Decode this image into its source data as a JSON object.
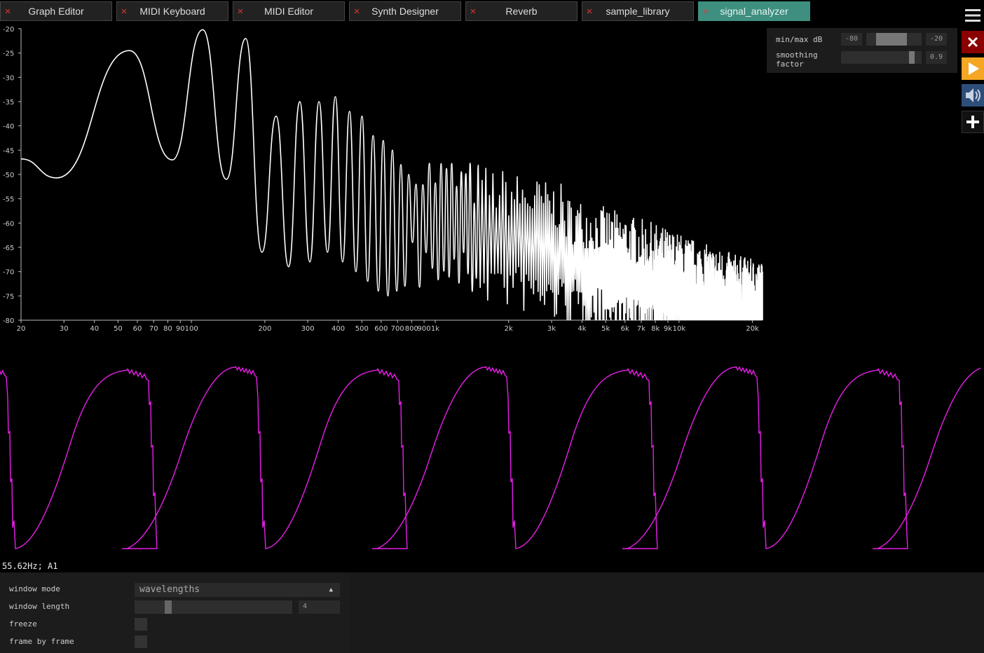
{
  "tabs": [
    {
      "label": "Graph Editor",
      "active": false
    },
    {
      "label": "MIDI Keyboard",
      "active": false
    },
    {
      "label": "MIDI Editor",
      "active": false
    },
    {
      "label": "Synth Designer",
      "active": false
    },
    {
      "label": "Reverb",
      "active": false
    },
    {
      "label": "sample_library",
      "active": true
    },
    {
      "label": "signal_analyzer",
      "active": true
    }
  ],
  "tab_close_glyph": "×",
  "sidebar": {
    "icons": [
      "menu-icon",
      "close-icon",
      "play-icon",
      "speaker-icon",
      "plus-icon"
    ],
    "colors": {
      "close": "#8b0000",
      "play": "#f5a623",
      "speaker": "#2e4e7a"
    }
  },
  "spectrum_controls": {
    "minmax_label": "min/max dB",
    "min_db": "-80",
    "max_db": "-20",
    "smoothing_label_1": "smoothing",
    "smoothing_label_2": "factor",
    "smoothing_value": "0.9"
  },
  "chart_data": {
    "type": "line",
    "x_scale": "log",
    "xlim": [
      20,
      22000
    ],
    "ylim": [
      -80,
      -20
    ],
    "y_ticks": [
      -20,
      -25,
      -30,
      -35,
      -40,
      -45,
      -50,
      -55,
      -60,
      -65,
      -70,
      -75,
      -80
    ],
    "x_ticks": [
      {
        "v": 20,
        "l": "20"
      },
      {
        "v": 30,
        "l": "30"
      },
      {
        "v": 40,
        "l": "40"
      },
      {
        "v": 50,
        "l": "50"
      },
      {
        "v": 60,
        "l": "60"
      },
      {
        "v": 70,
        "l": "70"
      },
      {
        "v": 80,
        "l": "80"
      },
      {
        "v": 90,
        "l": "90"
      },
      {
        "v": 100,
        "l": "100"
      },
      {
        "v": 200,
        "l": "200"
      },
      {
        "v": 300,
        "l": "300"
      },
      {
        "v": 400,
        "l": "400"
      },
      {
        "v": 500,
        "l": "500"
      },
      {
        "v": 600,
        "l": "600"
      },
      {
        "v": 700,
        "l": "700"
      },
      {
        "v": 800,
        "l": "800"
      },
      {
        "v": 900,
        "l": "900"
      },
      {
        "v": 1000,
        "l": "1k"
      },
      {
        "v": 2000,
        "l": "2k"
      },
      {
        "v": 3000,
        "l": "3k"
      },
      {
        "v": 4000,
        "l": "4k"
      },
      {
        "v": 5000,
        "l": "5k"
      },
      {
        "v": 6000,
        "l": "6k"
      },
      {
        "v": 7000,
        "l": "7k"
      },
      {
        "v": 8000,
        "l": "8k"
      },
      {
        "v": 9000,
        "l": "9k"
      },
      {
        "v": 10000,
        "l": "10k"
      },
      {
        "v": 20000,
        "l": "20k"
      }
    ],
    "harmonic_fundamental_hz": 55.62,
    "peaks_db": [
      -24.5,
      -20.2,
      -22.0,
      -38.0,
      -35.0,
      -35.0,
      -34.0,
      -37.0,
      -38.0,
      -42.0,
      -43.0,
      -45.0,
      -48.0,
      -50.0,
      -52.0
    ],
    "troughs_db": [
      -50.7,
      -47.0,
      -51.0,
      -66.0,
      -69.0,
      -68.0,
      -66.0,
      -68.0,
      -70.0,
      -72.0,
      -74.0,
      -75.0,
      -74.0,
      -73.0
    ],
    "noise_floor_db": [
      {
        "hz": 1000,
        "db": -58
      },
      {
        "hz": 2000,
        "db": -62
      },
      {
        "hz": 4000,
        "db": -66
      },
      {
        "hz": 8000,
        "db": -71
      },
      {
        "hz": 14000,
        "db": -76
      },
      {
        "hz": 22000,
        "db": -79
      }
    ],
    "series": [
      {
        "color": "#ffffff"
      }
    ]
  },
  "scope": {
    "color": "#e91ee9",
    "cycles": 6
  },
  "pitch_readout": "55.62Hz; A1",
  "bottom_controls": {
    "window_mode_label": "window mode",
    "window_mode_value": "wavelengths",
    "window_length_label": "window length",
    "window_length_value": "4",
    "window_length_fraction": 0.2,
    "freeze_label": "freeze",
    "frame_by_frame_label": "frame by frame"
  }
}
